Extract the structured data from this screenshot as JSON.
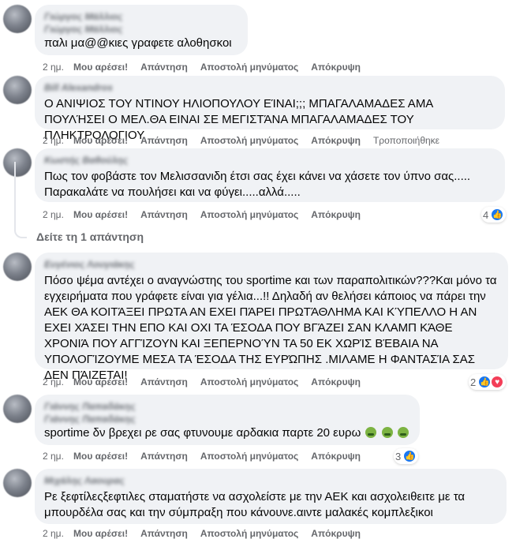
{
  "actions": {
    "like": "Μου αρέσει!",
    "reply": "Απάντηση",
    "send_message": "Αποστολή μηνύματος",
    "hide": "Απόκρυψη"
  },
  "comments": [
    {
      "author": "Γιώργος Μάλλιος",
      "author_line2": "Γιώργος Μάλλιος",
      "text": "παλι μα@@κιες γραφετε αλοθησκοι",
      "time": "2 ημ."
    },
    {
      "author": "Bill Alexandros",
      "text": "Ο ΑΝΙΨΙΟΣ ΤΟΥ ΝΤΙΝΟΥ ΗΛΙΟΠΟΥΛΟΥ ΕΊΝΑΙ;;; ΜΠΑΓΑΛΑΜΑΔΕΣ ΑΜΑ ΠΟΥΛΉΣΕΙ Ο ΜΕΛ.ΘΑ ΕΙΝΑΙ ΣΕ ΜΕΓΙΣΤΆΝΑ ΜΠΑΓΑΛΑΜΑΔΕΣ ΤΟΥ ΠΛΗΚΤΡΟΛΟΓΙΟΥ",
      "time": "2 ημ.",
      "edited": "Τροποποιήθηκε"
    },
    {
      "author": "Κωστής Βαθούλης",
      "text": "Πως τον φοβάστε τον Μελισσανιδη έτσι σας έχει κάνει να χάσετε τον ύπνο σας..... Παρακαλάτε να πουλήσει και να φύγει.....αλλά.....",
      "time": "2 ημ.",
      "reactions": "4",
      "view_replies": "Δείτε τη 1 απάντηση"
    },
    {
      "author": "Ευγένιος Λουγιάκης",
      "text": "Πόσο ψέμα αντέχει ο αναγνώστης του sportime και των παραπολιτικών???Και μόνο τα εγχειρήματα που γράφετε είναι για γέλια...!! Δηλαδή αν θελήσει κάποιος να πάρει την ΑΕΚ ΘΑ ΚΟΙΤΆΞΕΙ ΠΡΩΤΑ ΑΝ ΕΧΕΙ ΠΆΡΕΙ ΠΡΩΤΆΘΛΗΜΑ ΚΑΙ ΚΎΠΕΛΛΟ Η ΑΝ ΕΧΕΙ ΧΆΣΕΙ ΤΗΝ ΕΠΟ ΚΑΙ ΟΧΙ ΤΑ ΈΣΟΔΑ ΠΟΥ ΒΓΆΖΕΙ ΣΑΝ ΚΛΑΜΠ ΚΆΘΕ ΧΡΟΝΙΆ ΠΟΥ ΑΓΓΊΖΟΥΝ ΚΑΙ ΞΕΠΕΡΝΟΎΝ ΤΑ 50 ΕΚ ΧΩΡΊΣ ΒΈΒΑΙΑ ΝΑ ΥΠΟΛΟΓΊΖΟΥΜΕ ΜΕΣΑ ΤΑ ΈΣΟΔΑ ΤΗΣ ΕΥΡΏΠΗΣ .ΜΙΛΑΜΕ Η ΦΑΝΤΑΣΊΑ ΣΑΣ ΔΕΝ ΠΆΙΖΕΤΑΙ!",
      "time": "2 ημ.",
      "reactions": "2"
    },
    {
      "author": "Γιάννης Παπαδάκης",
      "author_line2": "Γιάννης Παπαδάκης",
      "text": "sportime δν βρεχει ρε σας φτυνουμε αρδακια παρτε 20 ευρω",
      "time": "2 ημ.",
      "reactions": "3"
    },
    {
      "author": "Μιχάλης Λαουρας",
      "text": "Ρε ξεφτίλεςξεφτιλες σταματήστε να ασχολείστε με την ΑΕΚ και ασχολειθειτε με τα μπουρδέλα σας και την σύμπραξη που κάνουνε.αιντε μαλακές κομπλεξικοι",
      "time": "2 ημ."
    }
  ],
  "colors": {
    "bubble": "#f0f2f5",
    "meta": "#65676b",
    "like": "#1877f2",
    "love": "#f33e58"
  }
}
